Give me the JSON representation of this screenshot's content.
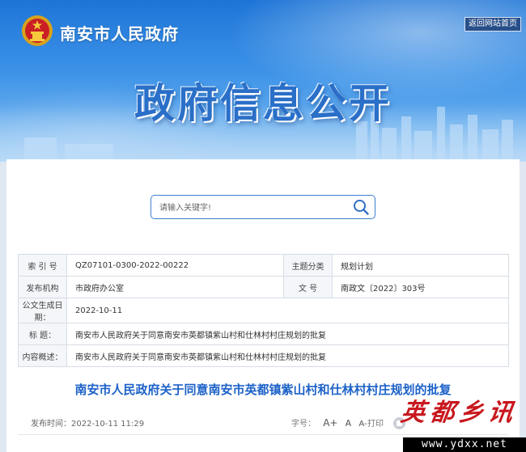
{
  "header": {
    "site_name": "南安市人民政府",
    "home_link": "返回网站首页",
    "banner_title": "政府信息公开"
  },
  "search": {
    "placeholder": "请输入关键字!",
    "value": ""
  },
  "info_table": {
    "index_label": "索 引 号",
    "index_value": "QZ07101-0300-2022-00222",
    "category_label": "主题分类",
    "category_value": "规划计划",
    "publisher_label": "发布机构",
    "publisher_value": "市政府办公室",
    "docno_label": "文 号",
    "docno_value": "南政文〔2022〕303号",
    "date_label": "公文生成日期：",
    "date_value": "2022-10-11",
    "title_label": "标 题：",
    "title_value": "南安市人民政府关于同意南安市英都镇紫山村和仕林村村庄规划的批复",
    "summary_label": "内容概述：",
    "summary_value": "南安市人民政府关于同意南安市英都镇紫山村和仕林村村庄规划的批复"
  },
  "article": {
    "title": "南安市人民政府关于同意南安市英都镇紫山村和仕林村村庄规划的批复",
    "publish_time": "发布时间：2022-10-11 11:29",
    "font_size_label": "字号：",
    "font_options": [
      "A+",
      "A",
      "A-"
    ],
    "print_label": "打印"
  },
  "watermark": {
    "text": "英都乡讯",
    "url": "www.ydxx.net"
  }
}
